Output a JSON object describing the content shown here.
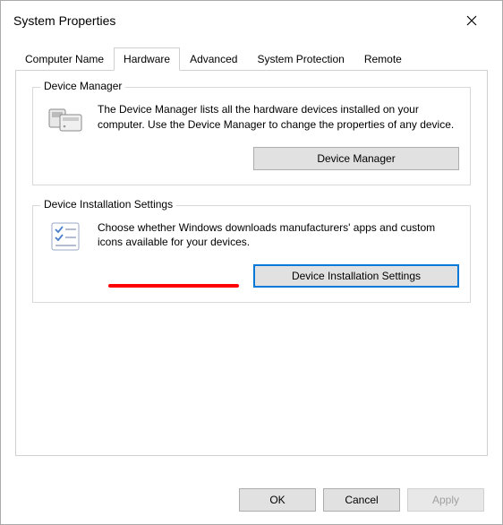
{
  "window": {
    "title": "System Properties"
  },
  "tabs": [
    {
      "label": "Computer Name"
    },
    {
      "label": "Hardware"
    },
    {
      "label": "Advanced"
    },
    {
      "label": "System Protection"
    },
    {
      "label": "Remote"
    }
  ],
  "group1": {
    "title": "Device Manager",
    "description": "The Device Manager lists all the hardware devices installed on your computer. Use the Device Manager to change the properties of any device.",
    "button": "Device Manager"
  },
  "group2": {
    "title": "Device Installation Settings",
    "description": "Choose whether Windows downloads manufacturers' apps and custom icons available for your devices.",
    "button": "Device Installation Settings"
  },
  "footer": {
    "ok": "OK",
    "cancel": "Cancel",
    "apply": "Apply"
  }
}
